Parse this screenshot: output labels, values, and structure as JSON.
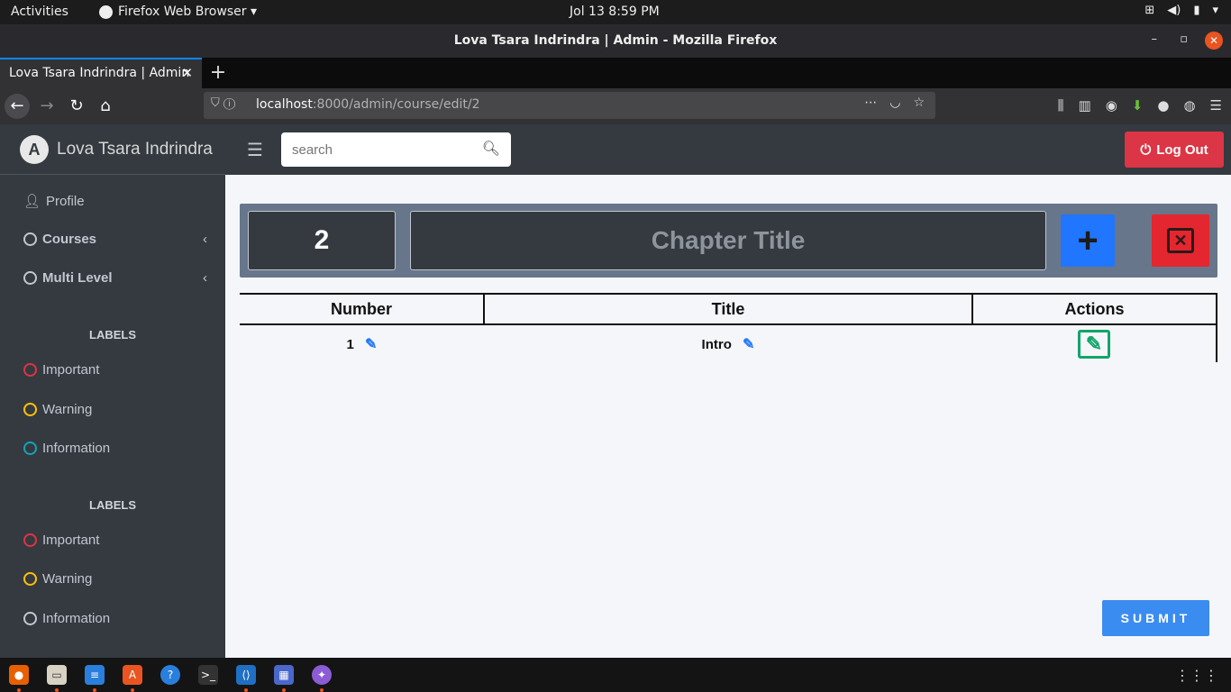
{
  "system": {
    "activities": "Activities",
    "app_menu": "Firefox Web Browser ▾",
    "clock": "Jol 13   8:59 PM"
  },
  "window": {
    "title": "Lova Tsara Indrindra | Admin - Mozilla Firefox"
  },
  "browser": {
    "tab_title": "Lova Tsara Indrindra | Admin",
    "url_host": "localhost",
    "url_path": ":8000/admin/course/edit/2"
  },
  "app": {
    "brand": "Lova Tsara Indrindra",
    "brand_logo": "A",
    "search_placeholder": "search",
    "logout_label": "Log Out"
  },
  "sidebar": {
    "items": [
      {
        "label": "Profile",
        "icon": "user-icon"
      },
      {
        "label": "Courses",
        "icon": "circle-icon"
      },
      {
        "label": "Multi Level",
        "icon": "circle-icon"
      }
    ],
    "sections": [
      {
        "header": "LABELS",
        "items": [
          {
            "label": "Important",
            "color": "#dc3545"
          },
          {
            "label": "Warning",
            "color": "#ffc107"
          },
          {
            "label": "Information",
            "color": "#17a2b8"
          }
        ]
      },
      {
        "header": "LABELS",
        "items": [
          {
            "label": "Important",
            "color": "#dc3545"
          },
          {
            "label": "Warning",
            "color": "#ffc107"
          },
          {
            "label": "Information",
            "color": "#c2c7d0"
          }
        ]
      }
    ]
  },
  "chapter_form": {
    "number_value": "2",
    "title_placeholder": "Chapter Title",
    "add_color": "#2176ff",
    "delete_color": "#e3262f"
  },
  "table": {
    "headers": [
      "Number",
      "Title",
      "Actions"
    ],
    "rows": [
      {
        "number": "1",
        "title": "Intro"
      }
    ]
  },
  "submit_label": "SUBMIT"
}
